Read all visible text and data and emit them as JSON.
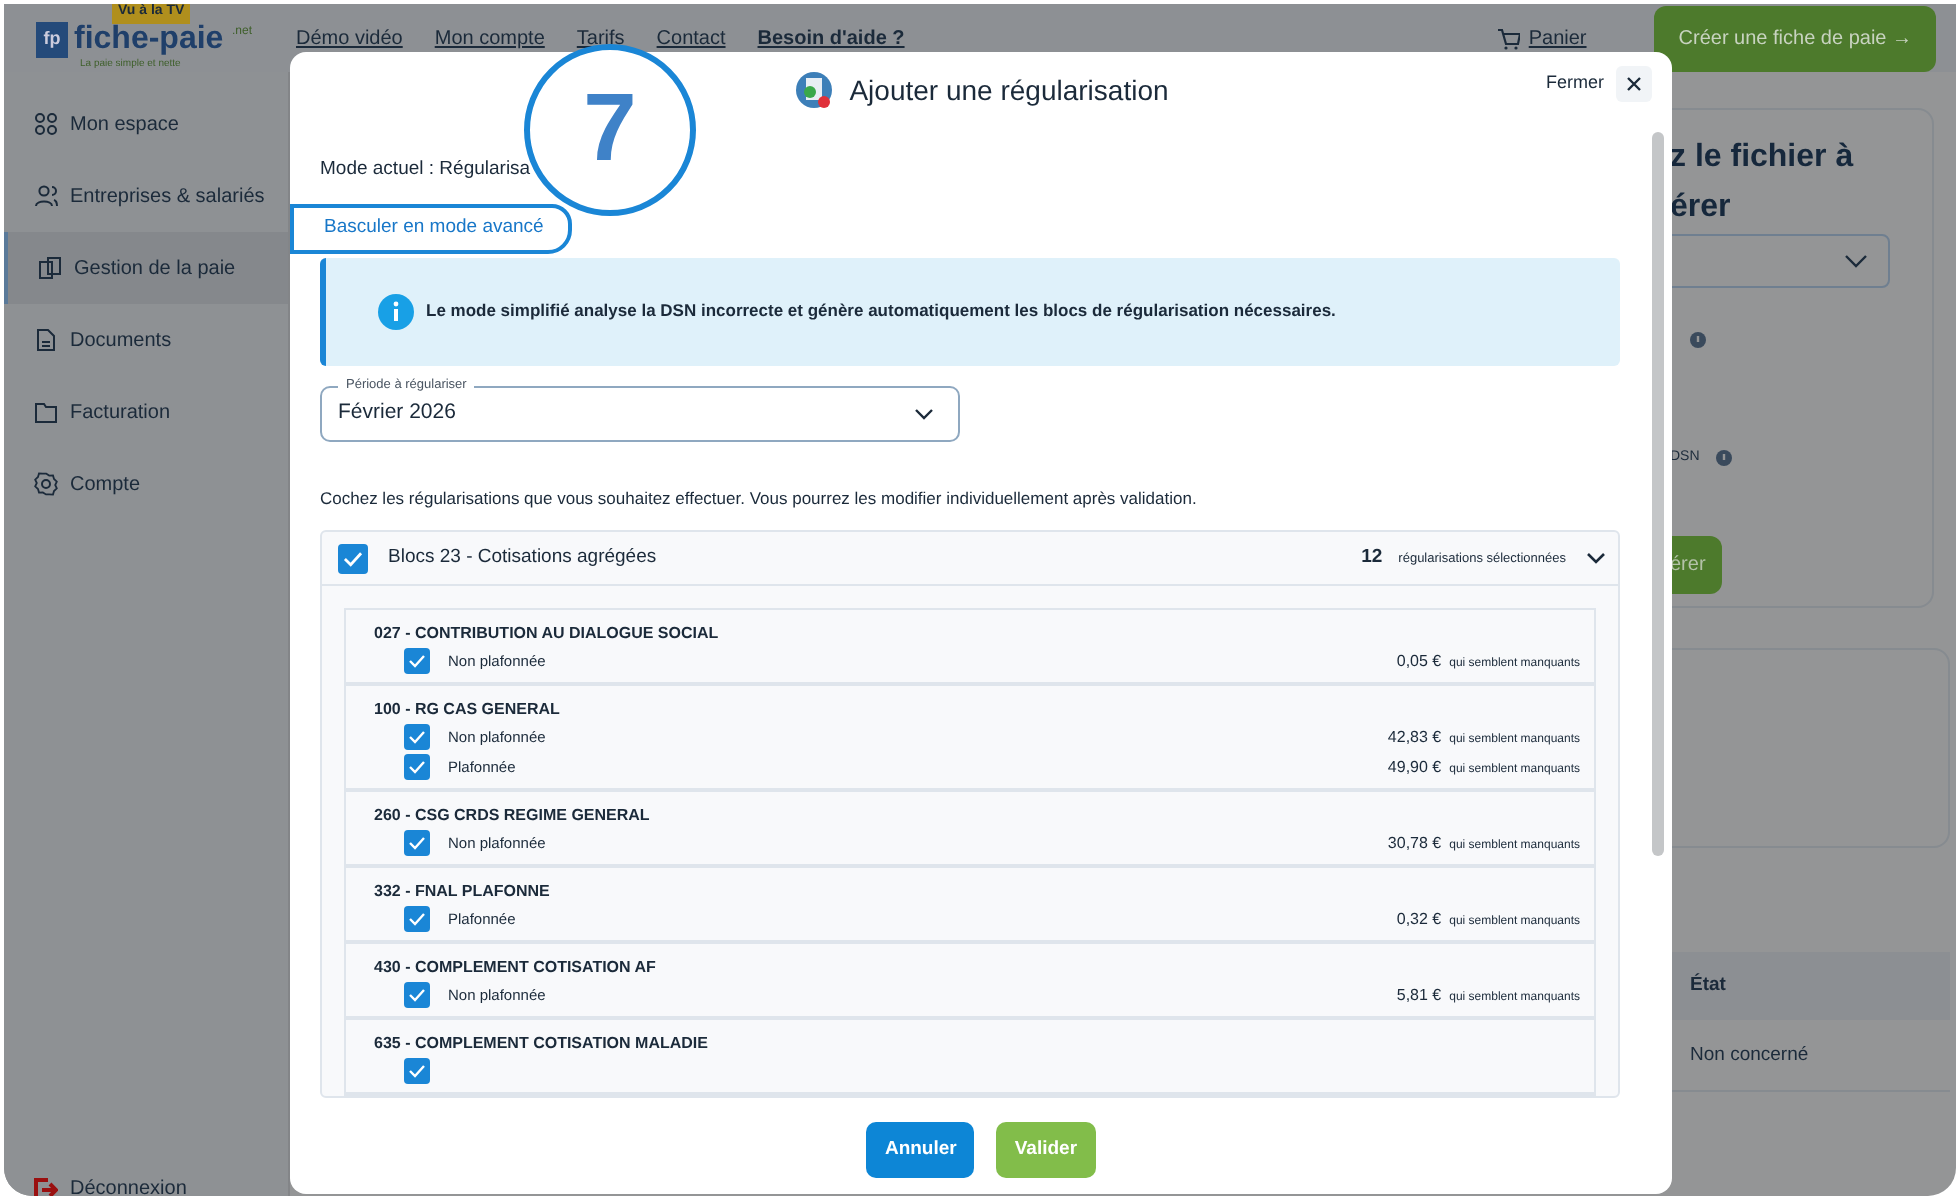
{
  "header": {
    "logo": {
      "mark": "fp",
      "badge": "Vu à la TV",
      "name": "fiche-paie",
      "suffix": ".net",
      "tagline": "La paie simple et nette"
    },
    "nav": [
      "Démo vidéo",
      "Mon compte",
      "Tarifs",
      "Contact",
      "Besoin d'aide ?"
    ],
    "cart": "Panier",
    "cta": "Créer une fiche de paie →"
  },
  "sidebar": {
    "items": [
      {
        "label": "Mon espace",
        "selected": false
      },
      {
        "label": "Entreprises & salariés",
        "selected": false
      },
      {
        "label": "Gestion de la paie",
        "selected": true
      },
      {
        "label": "Documents",
        "selected": false
      },
      {
        "label": "Facturation",
        "selected": false
      },
      {
        "label": "Compte",
        "selected": false
      }
    ],
    "logout": "Déconnexion"
  },
  "background_panel": {
    "heading_lines": [
      "z le fichier à",
      "érer"
    ],
    "help_text": "DSN",
    "button": "érer",
    "table": {
      "column": "État",
      "cell": "Non concerné"
    }
  },
  "modal": {
    "title": "Ajouter une régularisation",
    "close_label": "Fermer",
    "mode_text": "Mode actuel : Régularisa",
    "switch_link": "Basculer en mode avancé",
    "step_marker": "7",
    "info": "Le mode simplifié analyse la DSN incorrecte et génère automatiquement les blocs de régularisation nécessaires.",
    "period": {
      "label": "Période à régulariser",
      "value": "Février 2026"
    },
    "instruction": "Cochez les régularisations que vous souhaitez effectuer. Vous pourrez les modifier individuellement après validation.",
    "group": {
      "title": "Blocs 23 - Cotisations agrégées",
      "checked": true,
      "count": "12",
      "count_label": "régularisations sélectionnées",
      "expanded": true,
      "items": [
        {
          "title": "027 - CONTRIBUTION AU DIALOGUE SOCIAL",
          "lines": [
            {
              "label": "Non plafonnée",
              "checked": true,
              "amount": "0,05 €",
              "note": "qui semblent manquants"
            }
          ]
        },
        {
          "title": "100 - RG CAS GENERAL",
          "lines": [
            {
              "label": "Non plafonnée",
              "checked": true,
              "amount": "42,83 €",
              "note": "qui semblent manquants"
            },
            {
              "label": "Plafonnée",
              "checked": true,
              "amount": "49,90 €",
              "note": "qui semblent manquants"
            }
          ]
        },
        {
          "title": "260 - CSG CRDS REGIME GENERAL",
          "lines": [
            {
              "label": "Non plafonnée",
              "checked": true,
              "amount": "30,78 €",
              "note": "qui semblent manquants"
            }
          ]
        },
        {
          "title": "332 - FNAL PLAFONNE",
          "lines": [
            {
              "label": "Plafonnée",
              "checked": true,
              "amount": "0,32 €",
              "note": "qui semblent manquants"
            }
          ]
        },
        {
          "title": "430 - COMPLEMENT COTISATION AF",
          "lines": [
            {
              "label": "Non plafonnée",
              "checked": true,
              "amount": "5,81 €",
              "note": "qui semblent manquants"
            }
          ]
        },
        {
          "title": "635 - COMPLEMENT COTISATION MALADIE",
          "lines": [
            {
              "checked": true
            }
          ]
        }
      ]
    },
    "buttons": [
      {
        "label": "Annuler",
        "kind": "cancel"
      },
      {
        "label": "Valider",
        "kind": "confirm"
      }
    ]
  }
}
